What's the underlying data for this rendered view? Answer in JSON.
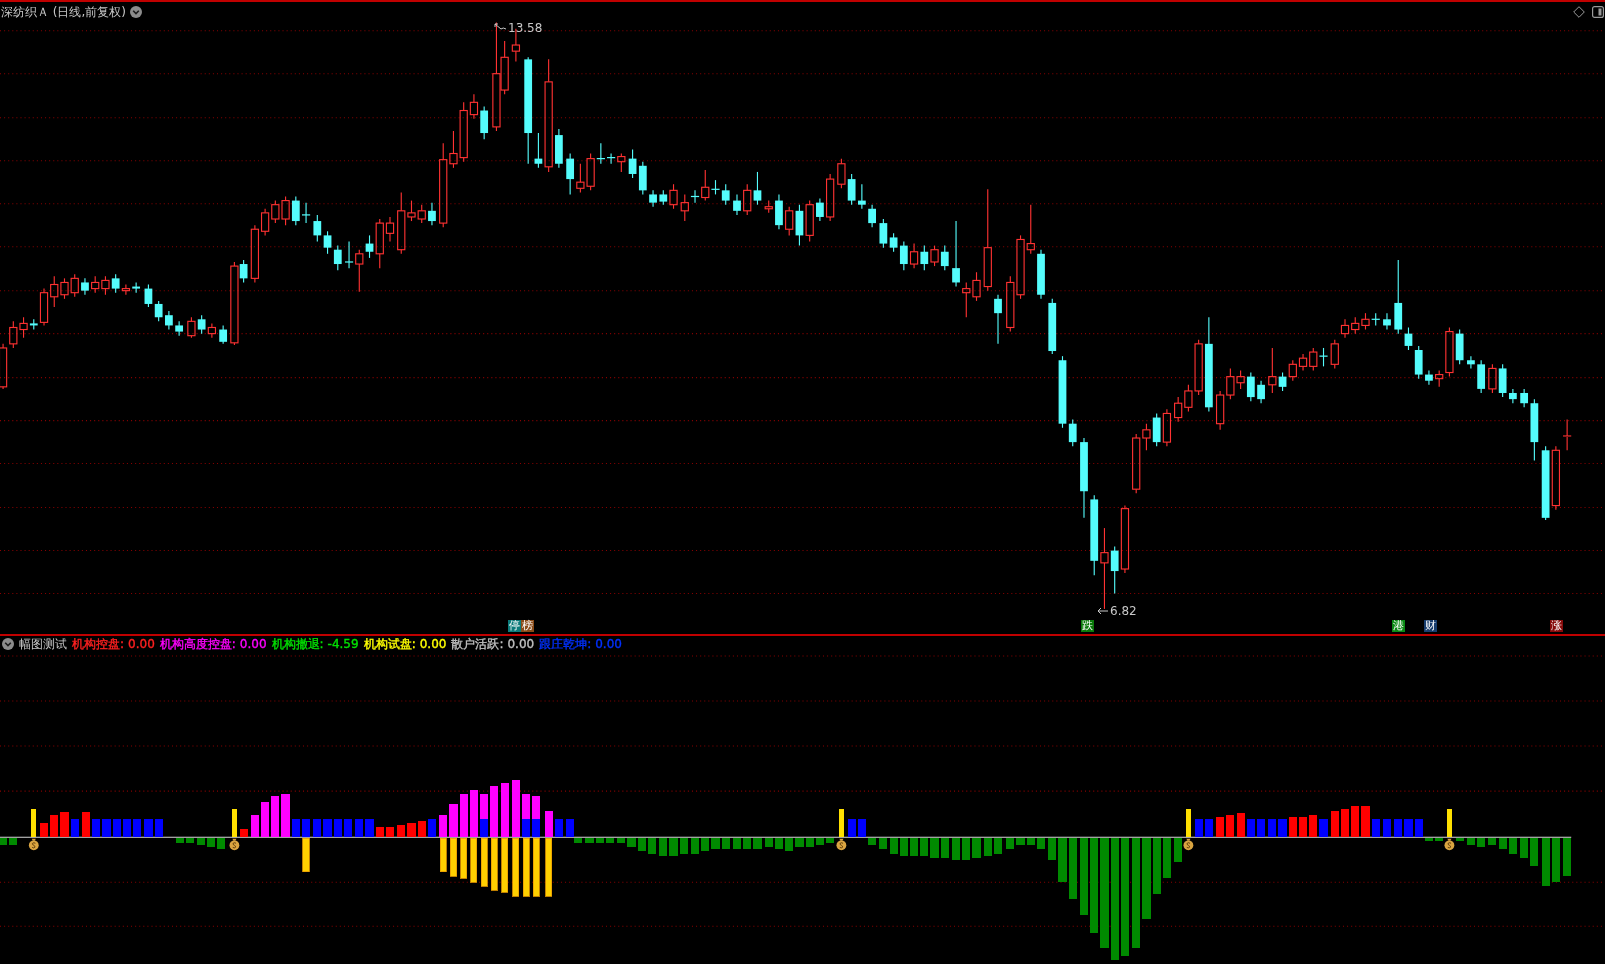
{
  "header": {
    "title": "深纺织Ａ (日线,前复权)"
  },
  "price_labels": [
    {
      "kind": "high",
      "text": "13.58"
    },
    {
      "kind": "low",
      "text": "6.82"
    }
  ],
  "event_tags": [
    {
      "text": "停",
      "color": "#0b7b7b"
    },
    {
      "text": "榜",
      "color": "#8a4b17"
    },
    {
      "text": "跌",
      "color": "#0a7a0a"
    },
    {
      "text": "港",
      "color": "#0a8a14"
    },
    {
      "text": "财",
      "color": "#173d6e"
    },
    {
      "text": "涨",
      "color": "#870b0b"
    }
  ],
  "indicator": {
    "name": "幅图测试",
    "values": [
      {
        "label": "机构控盘:",
        "value": "0.00",
        "color": "#ff2020"
      },
      {
        "label": "机构高度控盘:",
        "value": "0.00",
        "color": "#ff00ff"
      },
      {
        "label": "机构撤退:",
        "value": "-4.59",
        "color": "#00e000"
      },
      {
        "label": "机构试盘:",
        "value": "0.00",
        "color": "#ffff00"
      },
      {
        "label": "散户活跃:",
        "value": "0.00",
        "color": "#c0c0c0"
      },
      {
        "label": "跟庄乾坤:",
        "value": "0.00",
        "color": "#0030ff"
      }
    ]
  }
}
